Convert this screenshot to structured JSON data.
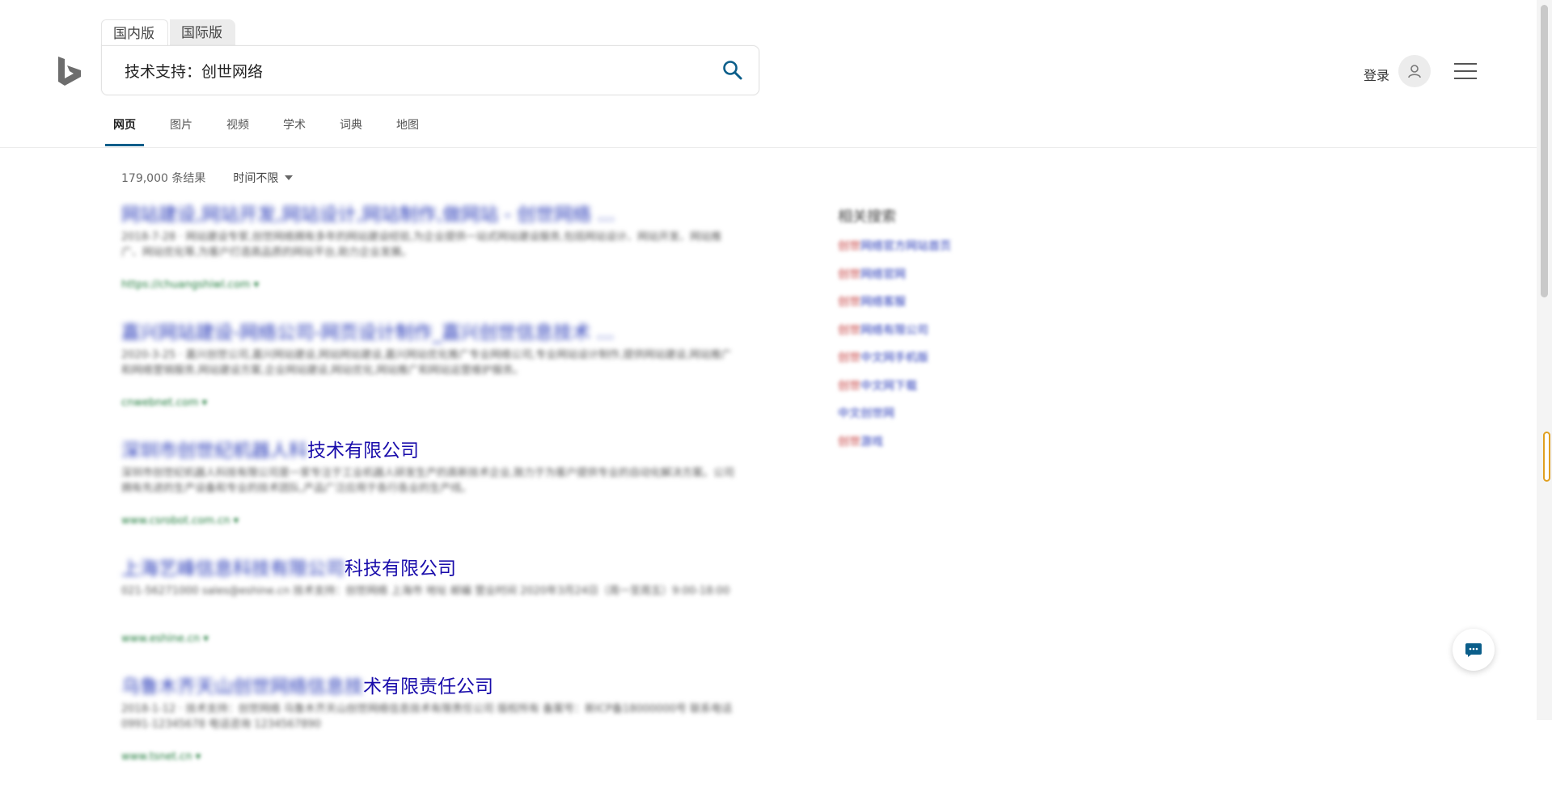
{
  "scope_tabs": [
    "国内版",
    "国际版"
  ],
  "search": {
    "query": "技术支持：创世网络"
  },
  "header": {
    "login_label": "登录"
  },
  "nav": {
    "items": [
      "网页",
      "图片",
      "视频",
      "学术",
      "词典",
      "地图"
    ]
  },
  "results_meta": {
    "count": "179,000 条结果",
    "time_filter": "时间不限"
  },
  "results": [
    {
      "title_blur": "网站建设,网站开发,网站设计,网站制作,做网站 - 创世网络 ...",
      "title_clear": "",
      "snippet": "2018-7-28 · 网站建设专家,创世网络拥有多年的网站建设经验,为企业提供一站式网站建设服务,包括网站设计、网站开发、网站推广、网站优化等,为客户打造高品质的网站平台,助力企业发展。",
      "url": "https://chuangshiwl.com ▾"
    },
    {
      "title_blur": "嘉兴网站建设-网络公司-网页设计制作_嘉兴创世信息技术 ...",
      "title_clear": "",
      "snippet": "2020-3-25 · 嘉兴创世公司,嘉兴网站建设,网站网站建设,嘉兴网站优化推广专业网络公司,专业网站设计制作,提供网站建设,网站推广和网络营销服务,网站建设方案,企业网站建设,网站优化,网站推广和网站运营维护服务。",
      "url": "cnwebnet.com ▾"
    },
    {
      "title_blur": "深圳市创世纪机器人科",
      "title_clear": "技术有限公司",
      "snippet": "深圳市创世纪机器人科技有限公司是一家专注于工业机器人研发生产的高新技术企业,致力于为客户提供专业的自动化解决方案。公司拥有先进的生产设备和专业的技术团队,产品广泛应用于各行各业的生产线。",
      "url": "www.csrobot.com.cn ▾"
    },
    {
      "title_blur": "上海艺峰信息科技有限公司",
      "title_clear": "科技有限公司",
      "snippet": "021-56271000 sales@eshine.cn 技术支持：创世网络 上海市 地址 邮编 营业时间 2020年3月24日（周一至周五）9:00-18:00",
      "url": "www.eshine.cn ▾"
    },
    {
      "title_blur": "乌鲁木齐天山创世网络信息技",
      "title_clear": "术有限责任公司",
      "snippet": "2018-1-12 · 技术支持：创世网络 乌鲁木齐天山创世网络信息技术有限责任公司 版权所有 备案号：新ICP备18000000号 联系电话 0991-12345678 电话咨询 1234567890",
      "url": "www.tsnet.cn ▾"
    }
  ],
  "related": {
    "title": "相关搜索",
    "items": [
      {
        "red": "创世",
        "blue": "网络官方网站首页"
      },
      {
        "red": "创世",
        "blue": "网络官网"
      },
      {
        "red": "创世",
        "blue": "网络客服"
      },
      {
        "red": "创世",
        "blue": "网络有限公司"
      },
      {
        "red": "创世",
        "blue": "中文网手机版"
      },
      {
        "red": "创世",
        "blue": "中文网下载"
      },
      {
        "red": "",
        "blue": "中文创世网"
      },
      {
        "red": "创世",
        "blue": "游戏"
      }
    ]
  }
}
